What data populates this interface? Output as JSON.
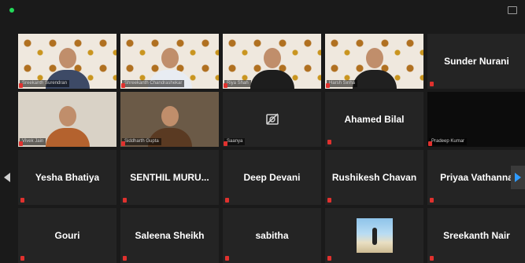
{
  "colors": {
    "background": "#1a1a1a",
    "tile": "#242424",
    "active_speaker": "#c9e34a",
    "muted": "#e0312e",
    "page_arrow": "#2f9bff"
  },
  "participants": [
    {
      "name": "",
      "label": "Sreekanth Surendran",
      "video": true,
      "bg": "pattern",
      "body": "blue"
    },
    {
      "name": "",
      "label": "Shreekanth Chandrashekar",
      "video": true,
      "bg": "pattern",
      "body": "light"
    },
    {
      "name": "",
      "label": "Riya Shah",
      "video": true,
      "bg": "pattern",
      "body": "black"
    },
    {
      "name": "",
      "label": "Harsh Sinha",
      "video": true,
      "bg": "pattern",
      "body": "suit",
      "active": true
    },
    {
      "name": "Sunder Nurani",
      "label": "",
      "video": false
    },
    {
      "name": "",
      "label": "Vivek Jain",
      "video": true,
      "bg": "plain",
      "body": "orange"
    },
    {
      "name": "",
      "label": "Siddharth Gupta",
      "video": true,
      "bg": "plain2",
      "body": "brown"
    },
    {
      "name": "",
      "label": "Saanya",
      "video": false,
      "cam_off": true
    },
    {
      "name": "Ahamed Bilal",
      "label": "",
      "video": false
    },
    {
      "name": "",
      "label": "Pradeep Kumar",
      "video": true,
      "bg": "dark",
      "body": "none"
    },
    {
      "name": "Yesha Bhatiya",
      "label": "",
      "video": false
    },
    {
      "name": "SENTHIL MURU...",
      "label": "",
      "video": false
    },
    {
      "name": "Deep Devani",
      "label": "",
      "video": false
    },
    {
      "name": "Rushikesh Chavan",
      "label": "",
      "video": false
    },
    {
      "name": "Priyaa Vathanna",
      "label": "",
      "video": false
    },
    {
      "name": "Gouri",
      "label": "",
      "video": false
    },
    {
      "name": "Saleena Sheikh",
      "label": "",
      "video": false
    },
    {
      "name": "sabitha",
      "label": "",
      "video": false
    },
    {
      "name": "",
      "label": "",
      "video": false,
      "thumb": true
    },
    {
      "name": "Sreekanth Nair",
      "label": "",
      "video": false
    }
  ],
  "icons": {
    "camera_off": "camera-off-icon",
    "mic_muted": "mic-muted-icon",
    "prev": "chevron-left-icon",
    "next": "chevron-right-icon"
  }
}
